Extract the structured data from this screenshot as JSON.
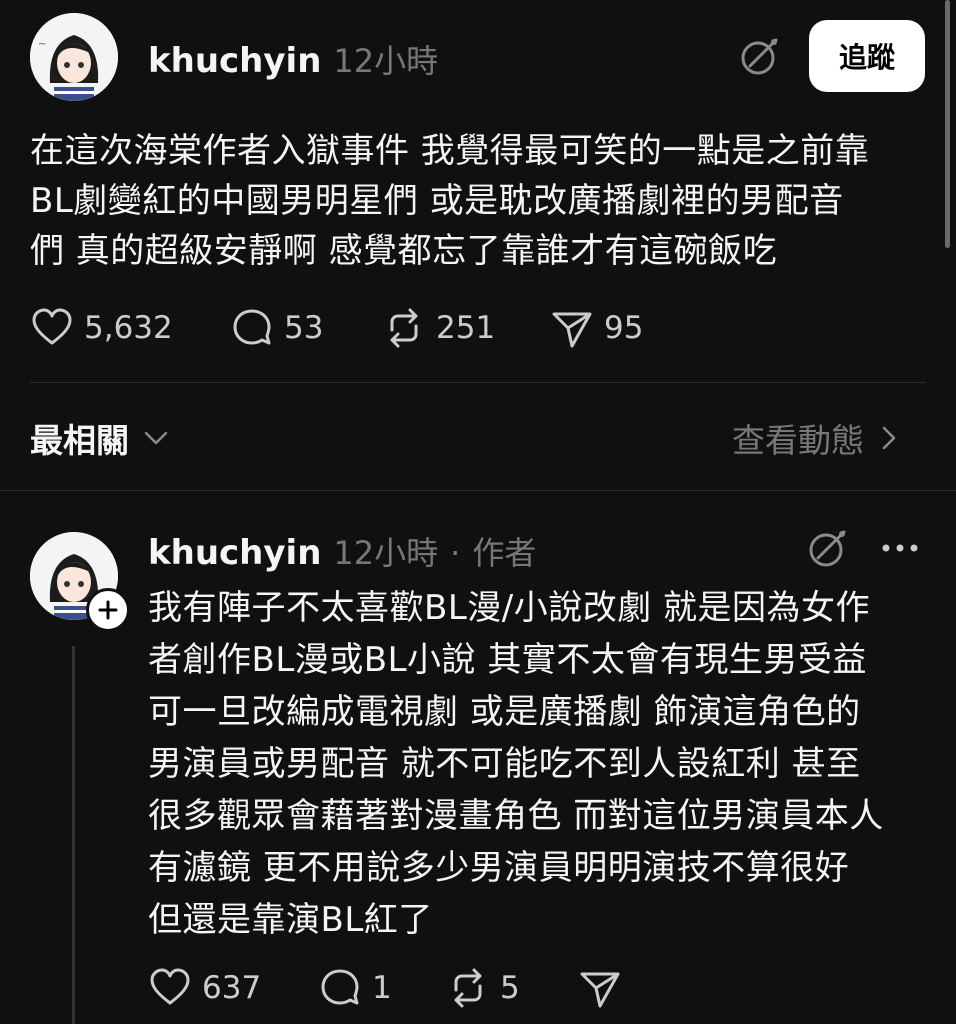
{
  "post": {
    "username": "khuchyin",
    "time": "12小時",
    "follow_label": "追蹤",
    "text": "在這次海棠作者入獄事件 我覺得最可笑的一點是之前靠\nBL劇變紅的中國男明星們 或是耽改廣播劇裡的男配音\n們 真的超級安靜啊 感覺都忘了靠誰才有這碗飯吃",
    "likes": "5,632",
    "replies": "53",
    "reposts": "251",
    "shares": "95"
  },
  "sort": {
    "label": "最相關",
    "view_activity": "查看動態"
  },
  "reply": {
    "username": "khuchyin",
    "time": "12小時",
    "separator": "·",
    "author_label": "作者",
    "text": "我有陣子不太喜歡BL漫/小說改劇 就是因為女作\n者創作BL漫或BL小說 其實不太會有現生男受益\n可一旦改編成電視劇 或是廣播劇 飾演這角色的\n男演員或男配音 就不可能吃不到人設紅利 甚至\n很多觀眾會藉著對漫畫角色 而對這位男演員本人\n有濾鏡 更不用說多少男演員明明演技不算很好\n但還是靠演BL紅了",
    "likes": "637",
    "replies": "1",
    "reposts": "5"
  }
}
